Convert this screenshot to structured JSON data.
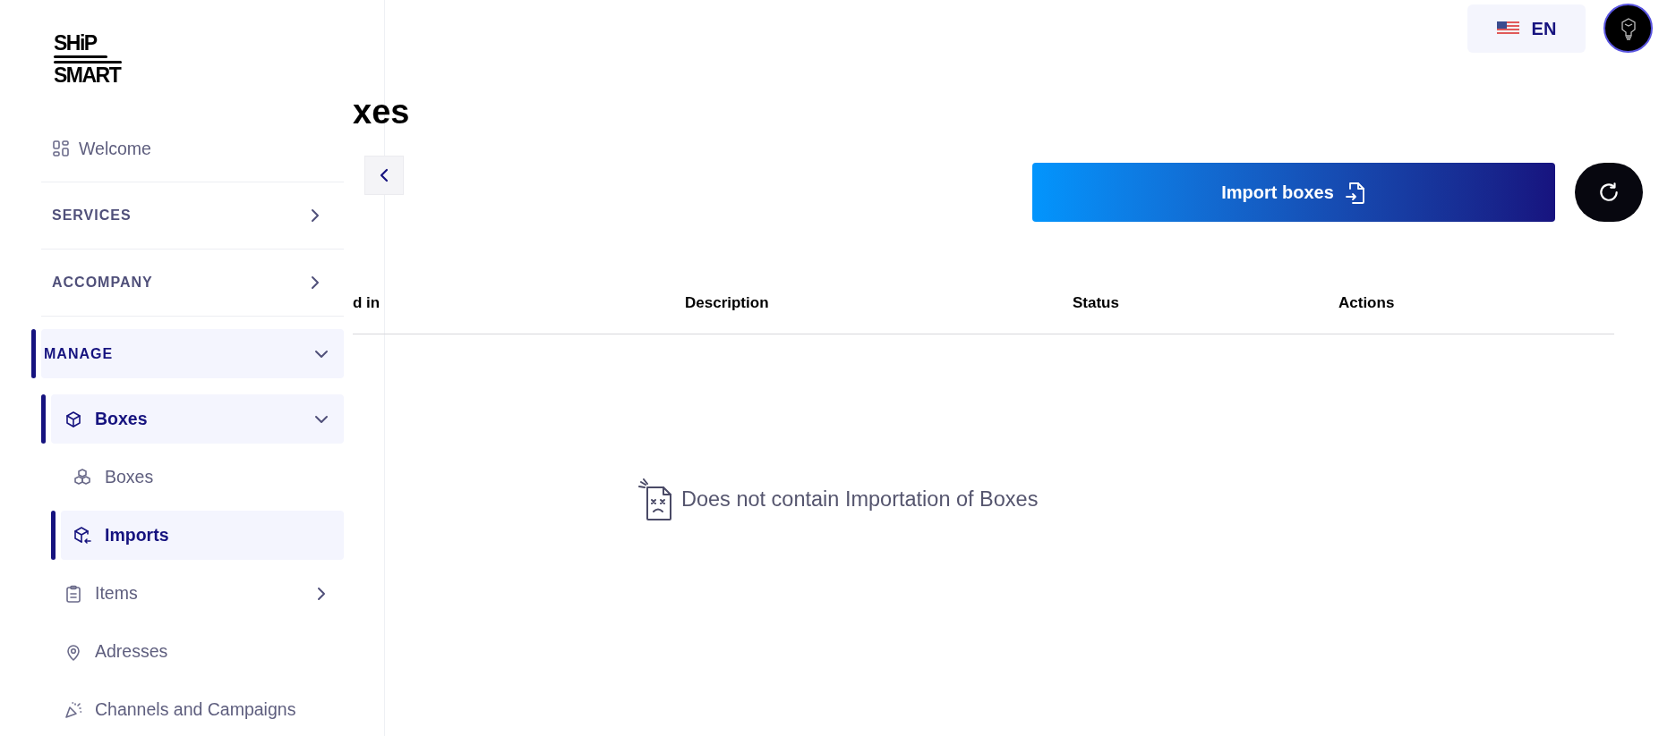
{
  "sidebar": {
    "logo": {
      "line_1": "SHiP",
      "line_2": "SMART"
    },
    "top_items": [
      {
        "kind": "link",
        "label": "Welcome"
      },
      {
        "kind": "section",
        "label": "SERVICES",
        "expanded": false
      },
      {
        "kind": "section",
        "label": "ACCOMPANY",
        "expanded": false
      }
    ],
    "tree": [
      {
        "label": "MANAGE",
        "selected": true,
        "expanded": true,
        "children": [
          {
            "label": "Boxes",
            "selected": true,
            "expanded": true,
            "children": [
              {
                "label": "Boxes",
                "selected": false
              },
              {
                "label": "Imports",
                "selected": true
              }
            ]
          },
          {
            "label": "Items",
            "selected": false,
            "expanded": false
          },
          {
            "label": "Adresses",
            "selected": false
          },
          {
            "label": "Channels and Campaigns",
            "selected": false
          }
        ]
      }
    ]
  },
  "header": {
    "language": "EN"
  },
  "main": {
    "title": "xes",
    "import_button": "Import boxes",
    "table": {
      "columns": [
        "d in",
        "Description",
        "Status",
        "Actions"
      ]
    },
    "empty_state": "Does not contain Importation of Boxes"
  }
}
